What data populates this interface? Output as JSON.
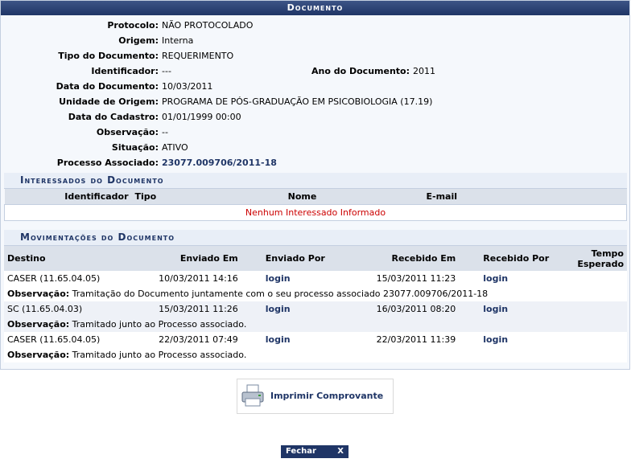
{
  "caption": "Documento",
  "props": {
    "protocolo_label": "Protocolo:",
    "protocolo": "NÃO PROTOCOLADO",
    "origem_label": "Origem:",
    "origem": "Interna",
    "tipo_label": "Tipo do Documento:",
    "tipo": "REQUERIMENTO",
    "identificador_label": "Identificador:",
    "identificador": "---",
    "ano_label": "Ano do Documento:",
    "ano": "2011",
    "data_label": "Data do Documento:",
    "data": "10/03/2011",
    "unidade_label": "Unidade de Origem:",
    "unidade": "PROGRAMA DE PÓS-GRADUAÇÃO EM PSICOBIOLOGIA (17.19)",
    "cadastro_label": "Data do Cadastro:",
    "cadastro": "01/01/1999 00:00",
    "observacao_label": "Observação:",
    "observacao": "--",
    "situacao_label": "Situação:",
    "situacao": "ATIVO",
    "processo_label": "Processo Associado:",
    "processo": "23077.009706/2011-18"
  },
  "interessados": {
    "caption": "Interessados do Documento",
    "headers": [
      "Identificador",
      "Tipo",
      "Nome",
      "E-mail"
    ],
    "empty": "Nenhum Interessado Informado"
  },
  "movimentacoes": {
    "caption": "Movimentações do Documento",
    "headers": [
      "Destino",
      "Enviado Em",
      "Enviado Por",
      "Recebido Em",
      "Recebido Por",
      "Tempo Esperado"
    ],
    "obs_label": "Observação:",
    "rows": [
      {
        "destino": "CASER (11.65.04.05)",
        "enviado_em": "10/03/2011 14:16",
        "enviado_por": "login",
        "recebido_em": "15/03/2011 11:23",
        "recebido_por": "login",
        "obs": "Tramitação do Documento juntamente com o seu processo associado 23077.009706/2011-18"
      },
      {
        "destino": "SC (11.65.04.03)",
        "enviado_em": "15/03/2011 11:26",
        "enviado_por": "login",
        "recebido_em": "16/03/2011 08:20",
        "recebido_por": "login",
        "obs": "Tramitado junto ao Processo associado."
      },
      {
        "destino": "CASER (11.65.04.05)",
        "enviado_em": "22/03/2011 07:49",
        "enviado_por": "login",
        "recebido_em": "22/03/2011 11:39",
        "recebido_por": "login",
        "obs": "Tramitado junto ao Processo associado."
      }
    ]
  },
  "actions": {
    "print_label": "Imprimir Comprovante",
    "close_label": "Fechar",
    "close_x": "X"
  }
}
